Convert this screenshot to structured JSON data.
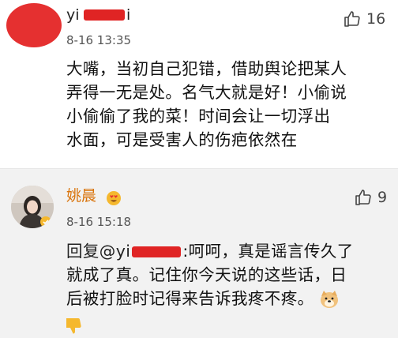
{
  "comments": [
    {
      "username_visible": "yi",
      "username_tail": "i",
      "timestamp": "8-16 13:35",
      "likes": "16",
      "text_lines": [
        "大嘴，当初自己犯错，借助舆论把某人",
        "弄得一无是处。名气大就是好！小偷说",
        "小偷偷了我的菜！时间会让一切浮出",
        "水面，可是受害人的伤疤依然在"
      ]
    },
    {
      "username": "姚晨",
      "timestamp": "8-16 15:18",
      "likes": "9",
      "reply_prefix": "回复@yi",
      "reply_rest": ":呵呵，真是谣言传久了",
      "text_lines": [
        "就成了真。记住你今天说的这些话，日",
        "后被打脸时记得来告诉我疼不疼。"
      ]
    }
  ],
  "icons": {
    "like": "thumbs-up-outline-icon",
    "dislike": "thumbs-down-icon",
    "badge": "heart-eyes-emoji-icon",
    "reaction": "doge-emoji-icon"
  },
  "colors": {
    "redaction": "#e02424",
    "reply_background": "#f2f2f2",
    "emoji": "#f5b82e"
  }
}
